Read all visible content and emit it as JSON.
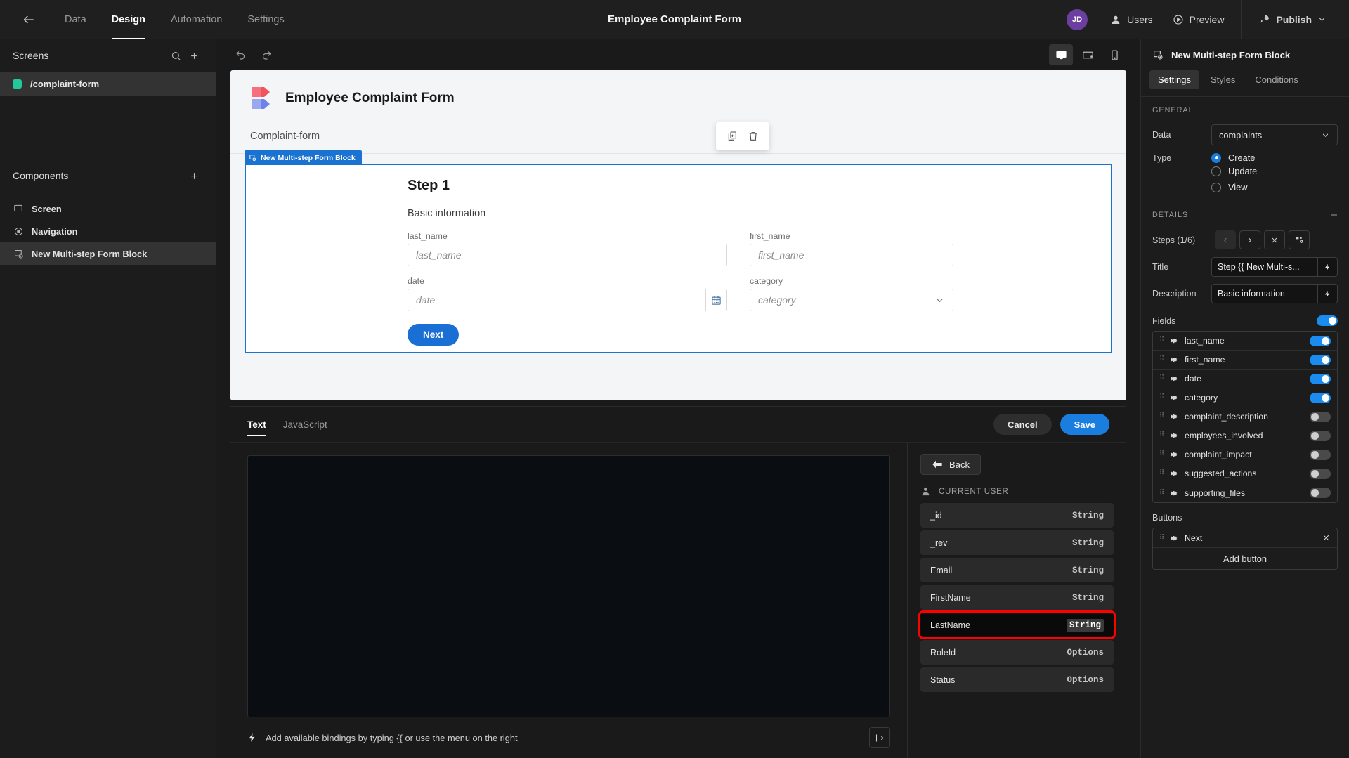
{
  "topbar": {
    "back_icon": "arrow-left-icon",
    "nav": [
      {
        "label": "Data",
        "active": false
      },
      {
        "label": "Design",
        "active": true
      },
      {
        "label": "Automation",
        "active": false
      },
      {
        "label": "Settings",
        "active": false
      }
    ],
    "title": "Employee Complaint Form",
    "avatar_initials": "JD",
    "avatar_color": "#6b3fa0",
    "users_label": "Users",
    "preview_label": "Preview",
    "publish_label": "Publish"
  },
  "left_panel": {
    "screens_title": "Screens",
    "search_icon": "search-icon",
    "add_icon": "plus-icon",
    "screens": [
      {
        "label": "/complaint-form",
        "active": true,
        "dot_color": "#22c79a"
      }
    ],
    "components_title": "Components",
    "components_add_icon": "plus-icon",
    "components": [
      {
        "label": "Screen",
        "icon": "screen-icon",
        "active": false
      },
      {
        "label": "Navigation",
        "icon": "eye-icon",
        "active": false
      },
      {
        "label": "New Multi-step Form Block",
        "icon": "multistep-form-icon",
        "active": true
      }
    ]
  },
  "canvas_toolbar": {
    "undo_icon": "undo-icon",
    "redo_icon": "redo-icon",
    "devices": [
      {
        "name": "desktop-icon",
        "active": true
      },
      {
        "name": "tablet-icon",
        "active": false
      },
      {
        "name": "mobile-icon",
        "active": false
      }
    ]
  },
  "canvas": {
    "app_title": "Employee Complaint Form",
    "screen_label": "Complaint-form",
    "float_tools": [
      {
        "icon": "duplicate-icon"
      },
      {
        "icon": "trash-icon"
      }
    ],
    "block_tag": "New Multi-step Form Block",
    "step_title": "Step 1",
    "step_description": "Basic information",
    "fields": [
      {
        "label": "last_name",
        "placeholder": "last_name",
        "type": "text"
      },
      {
        "label": "first_name",
        "placeholder": "first_name",
        "type": "text"
      },
      {
        "label": "date",
        "placeholder": "date",
        "type": "date"
      },
      {
        "label": "category",
        "placeholder": "category",
        "type": "select"
      }
    ],
    "next_label": "Next"
  },
  "drawer": {
    "tabs": [
      {
        "label": "Text",
        "active": true
      },
      {
        "label": "JavaScript",
        "active": false
      }
    ],
    "cancel_label": "Cancel",
    "save_label": "Save",
    "code_value": "",
    "footer_hint": "Add available bindings by typing {{ or use the menu on the right",
    "expand_icon": "expand-panel-icon",
    "bindings": {
      "back_label": "Back",
      "section_title": "CURRENT USER",
      "user_icon": "user-icon",
      "rows": [
        {
          "name": "_id",
          "type": "String",
          "highlighted": false
        },
        {
          "name": "_rev",
          "type": "String",
          "highlighted": false
        },
        {
          "name": "Email",
          "type": "String",
          "highlighted": false
        },
        {
          "name": "FirstName",
          "type": "String",
          "highlighted": false
        },
        {
          "name": "LastName",
          "type": "String",
          "highlighted": true
        },
        {
          "name": "RoleId",
          "type": "Options",
          "highlighted": false
        },
        {
          "name": "Status",
          "type": "Options",
          "highlighted": false
        }
      ],
      "highlight_color": "#ff0000"
    }
  },
  "right_panel": {
    "header_title": "New Multi-step Form Block",
    "header_icon": "multistep-form-icon",
    "tabs": [
      {
        "label": "Settings",
        "active": true
      },
      {
        "label": "Styles",
        "active": false
      },
      {
        "label": "Conditions",
        "active": false
      }
    ],
    "general": {
      "section_title": "GENERAL",
      "data_label": "Data",
      "data_value": "complaints",
      "type_label": "Type",
      "type_options": [
        {
          "label": "Create",
          "selected": true
        },
        {
          "label": "Update",
          "selected": false
        },
        {
          "label": "View",
          "selected": false
        }
      ]
    },
    "details": {
      "section_title": "DETAILS",
      "collapse_icon": "minus-icon",
      "steps_label": "Steps (1/6)",
      "step_buttons": [
        {
          "icon": "chevron-left-icon",
          "disabled": true
        },
        {
          "icon": "chevron-right-icon",
          "disabled": false
        },
        {
          "icon": "close-icon",
          "disabled": false
        },
        {
          "icon": "add-step-icon",
          "disabled": false
        }
      ],
      "title_label": "Title",
      "title_value": "Step {{ New Multi-s...",
      "description_label": "Description",
      "description_value": "Basic information",
      "bolt_icon": "lightning-icon"
    },
    "fields_section": {
      "label": "Fields",
      "master_toggle": true,
      "items": [
        {
          "name": "last_name",
          "enabled": true
        },
        {
          "name": "first_name",
          "enabled": true
        },
        {
          "name": "date",
          "enabled": true
        },
        {
          "name": "category",
          "enabled": true
        },
        {
          "name": "complaint_description",
          "enabled": false
        },
        {
          "name": "employees_involved",
          "enabled": false
        },
        {
          "name": "complaint_impact",
          "enabled": false
        },
        {
          "name": "suggested_actions",
          "enabled": false
        },
        {
          "name": "supporting_files",
          "enabled": false
        }
      ]
    },
    "buttons_section": {
      "label": "Buttons",
      "items": [
        {
          "name": "Next",
          "remove_icon": "close-icon"
        }
      ],
      "add_label": "Add button"
    }
  }
}
